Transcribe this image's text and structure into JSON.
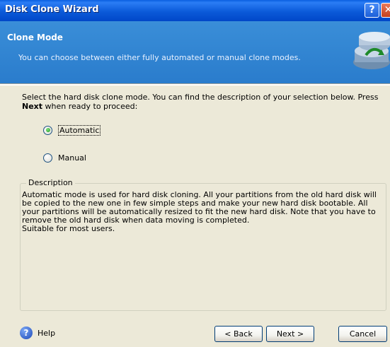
{
  "window": {
    "title": "Disk Clone Wizard",
    "help_glyph": "?",
    "close_glyph": "✕"
  },
  "header": {
    "title": "Clone Mode",
    "subtitle": "You can choose between either fully automated or manual clone modes."
  },
  "intro": {
    "text_before": "Select the hard disk clone mode. You can find the description of your selection below. Press ",
    "bold": "Next",
    "text_after": " when ready to proceed:"
  },
  "options": {
    "automatic": "Automatic",
    "manual": "Manual",
    "selected": "Automatic"
  },
  "description": {
    "legend": "Description",
    "text": "Automatic mode is used for hard disk cloning. All your partitions from the old hard disk will be copied to the new one in few simple steps and make your new hard disk bootable. All your partitions will be automatically resized to fit the new hard disk. Note that you have to remove the old hard disk when data moving is completed.",
    "text2": "Suitable for most users."
  },
  "footer": {
    "help_label": "Help",
    "help_icon": "?",
    "back_label": "< Back",
    "next_label": "Next >",
    "cancel_label": "Cancel"
  },
  "colors": {
    "titlebar": "#0b5ad9",
    "header": "#2a7ccc",
    "dialog_bg": "#ece9d8"
  }
}
